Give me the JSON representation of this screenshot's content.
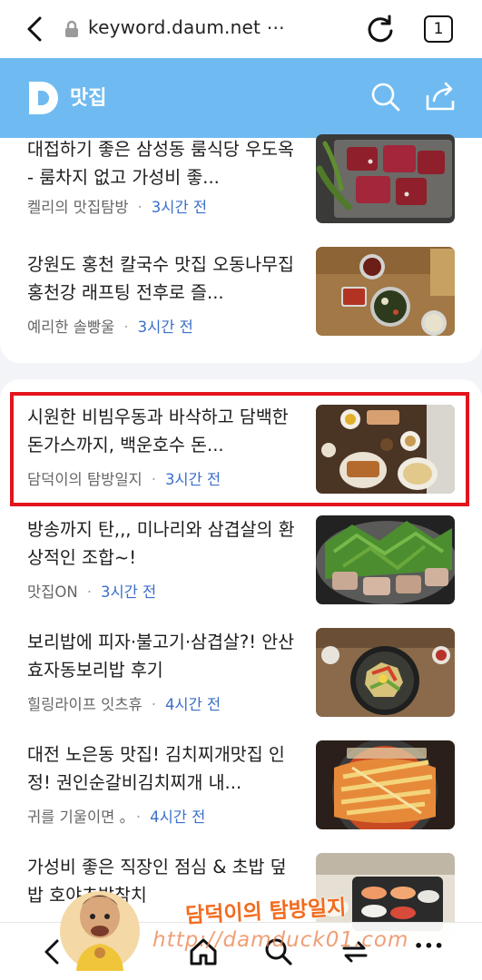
{
  "browser": {
    "url": "keyword.daum.net ⋯",
    "tab_count": "1",
    "icons": [
      "back-arrow-icon",
      "lock-icon",
      "reload-icon",
      "tab-count-icon"
    ]
  },
  "header": {
    "logo_icon": "daum-d-logo-icon",
    "title": "맛집",
    "brand_color": "#6fbbf1",
    "icons": [
      "search-icon",
      "share-icon"
    ]
  },
  "feed": {
    "top_card": [
      {
        "title": "대접하기 좋은 삼성동 룸식당 우도옥 - 룸차지 없고 가성비 좋...",
        "source": "켈리의 맛집탐방",
        "time": "3시간 전"
      },
      {
        "title": "강원도 홍천 칼국수 맛집 오동나무집 홍천강 래프팅 전후로 즐...",
        "source": "예리한 솔빵울",
        "time": "3시간 전"
      }
    ],
    "main_card": [
      {
        "title": "시원한 비빔우동과 바삭하고 담백한 돈가스까지, 백운호수 돈...",
        "source": "담덕이의 탐방일지",
        "time": "3시간 전",
        "highlighted": true
      },
      {
        "title": "방송까지 탄,,, 미나리와 삼겹살의 환상적인 조합~!",
        "source": "맛집ON",
        "time": "3시간 전"
      },
      {
        "title": "보리밥에 피자·불고기·삼겹살?! 안산 효자동보리밥 후기",
        "source": "힐링라이프 잇츠휴",
        "time": "4시간 전"
      },
      {
        "title": "대전 노은동 맛집! 김치찌개맛집 인정! 권인순갈비김치찌개 내...",
        "source": "귀를 기울이면 。",
        "time": "4시간 전"
      },
      {
        "title": "가성비 좋은 직장인 점심 & 초밥 덮밥 호야초밥참치"
      }
    ],
    "separator": "·",
    "highlight_color": "#e4141c"
  },
  "bottom_nav": {
    "icons": [
      "back-icon",
      "forward-icon",
      "home-icon",
      "search-icon",
      "tabs-icon",
      "more-icon"
    ],
    "more_label": "•••"
  },
  "watermark": {
    "title": "담덕이의 탐방일지",
    "url": "http://damduck01.com"
  }
}
